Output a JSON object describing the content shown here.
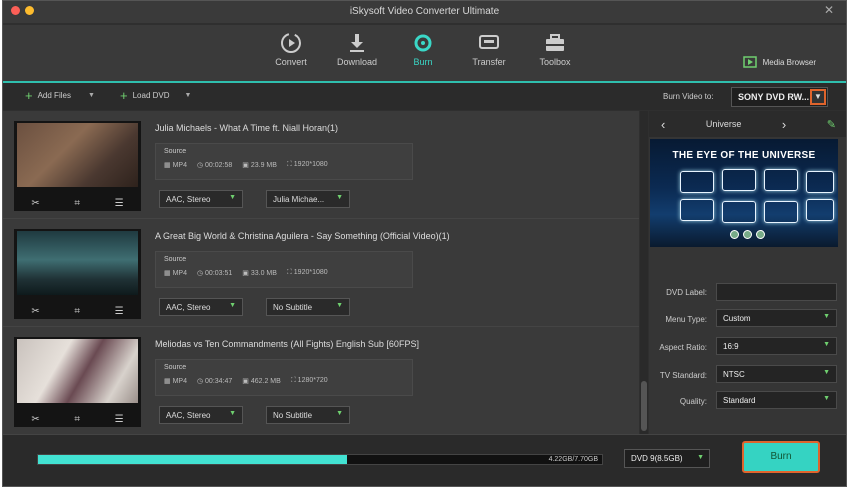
{
  "window": {
    "title": "iSkysoft Video Converter Ultimate",
    "close": "✕"
  },
  "tabs": [
    {
      "label": "Convert"
    },
    {
      "label": "Download"
    },
    {
      "label": "Burn"
    },
    {
      "label": "Transfer"
    },
    {
      "label": "Toolbox"
    }
  ],
  "media_browser": "Media Browser",
  "toolbar": {
    "add_files": "Add Files",
    "load_dvd": "Load DVD",
    "burn_to_label": "Burn Video to:",
    "burn_to_value": "SONY DVD RW..."
  },
  "videos": [
    {
      "title": "Julia Michaels - What A Time ft. Niall Horan(1)",
      "source": "Source",
      "format": "MP4",
      "duration": "00:02:58",
      "size": "23.9 MB",
      "resolution": "1920*1080",
      "audio": "AAC, Stereo",
      "subtitle": "Julia Michae..."
    },
    {
      "title": "A Great Big World & Christina Aguilera - Say Something (Official Video)(1)",
      "source": "Source",
      "format": "MP4",
      "duration": "00:03:51",
      "size": "33.0 MB",
      "resolution": "1920*1080",
      "audio": "AAC, Stereo",
      "subtitle": "No Subtitle"
    },
    {
      "title": "Meliodas vs Ten Commandments (All Fights) English Sub [60FPS]",
      "source": "Source",
      "format": "MP4",
      "duration": "00:34:47",
      "size": "462.2 MB",
      "resolution": "1280*720",
      "audio": "AAC, Stereo",
      "subtitle": "No Subtitle"
    }
  ],
  "template": {
    "name": "Universe",
    "preview_title": "THE EYE OF THE UNIVERSE"
  },
  "settings": {
    "dvd_label": {
      "label": "DVD Label:",
      "value": ""
    },
    "menu_type": {
      "label": "Menu Type:",
      "value": "Custom"
    },
    "aspect_ratio": {
      "label": "Aspect Ratio:",
      "value": "16:9"
    },
    "tv_standard": {
      "label": "TV Standard:",
      "value": "NTSC"
    },
    "quality": {
      "label": "Quality:",
      "value": "Standard"
    }
  },
  "footer": {
    "usage": "4.22GB/7.70GB",
    "usage_fraction": 0.548,
    "disc_type": "DVD 9(8.5GB)",
    "burn_label": "Burn"
  },
  "colors": {
    "accent": "#35d3c2",
    "highlight": "#e0642c"
  }
}
